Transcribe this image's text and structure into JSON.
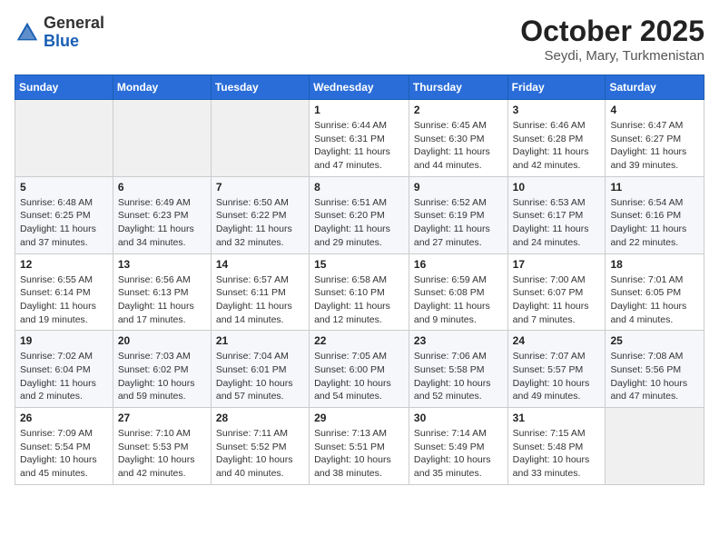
{
  "header": {
    "logo_general": "General",
    "logo_blue": "Blue",
    "month_year": "October 2025",
    "location": "Seydi, Mary, Turkmenistan"
  },
  "weekdays": [
    "Sunday",
    "Monday",
    "Tuesday",
    "Wednesday",
    "Thursday",
    "Friday",
    "Saturday"
  ],
  "weeks": [
    [
      {
        "day": "",
        "sunrise": "",
        "sunset": "",
        "daylight": ""
      },
      {
        "day": "",
        "sunrise": "",
        "sunset": "",
        "daylight": ""
      },
      {
        "day": "",
        "sunrise": "",
        "sunset": "",
        "daylight": ""
      },
      {
        "day": "1",
        "sunrise": "Sunrise: 6:44 AM",
        "sunset": "Sunset: 6:31 PM",
        "daylight": "Daylight: 11 hours and 47 minutes."
      },
      {
        "day": "2",
        "sunrise": "Sunrise: 6:45 AM",
        "sunset": "Sunset: 6:30 PM",
        "daylight": "Daylight: 11 hours and 44 minutes."
      },
      {
        "day": "3",
        "sunrise": "Sunrise: 6:46 AM",
        "sunset": "Sunset: 6:28 PM",
        "daylight": "Daylight: 11 hours and 42 minutes."
      },
      {
        "day": "4",
        "sunrise": "Sunrise: 6:47 AM",
        "sunset": "Sunset: 6:27 PM",
        "daylight": "Daylight: 11 hours and 39 minutes."
      }
    ],
    [
      {
        "day": "5",
        "sunrise": "Sunrise: 6:48 AM",
        "sunset": "Sunset: 6:25 PM",
        "daylight": "Daylight: 11 hours and 37 minutes."
      },
      {
        "day": "6",
        "sunrise": "Sunrise: 6:49 AM",
        "sunset": "Sunset: 6:23 PM",
        "daylight": "Daylight: 11 hours and 34 minutes."
      },
      {
        "day": "7",
        "sunrise": "Sunrise: 6:50 AM",
        "sunset": "Sunset: 6:22 PM",
        "daylight": "Daylight: 11 hours and 32 minutes."
      },
      {
        "day": "8",
        "sunrise": "Sunrise: 6:51 AM",
        "sunset": "Sunset: 6:20 PM",
        "daylight": "Daylight: 11 hours and 29 minutes."
      },
      {
        "day": "9",
        "sunrise": "Sunrise: 6:52 AM",
        "sunset": "Sunset: 6:19 PM",
        "daylight": "Daylight: 11 hours and 27 minutes."
      },
      {
        "day": "10",
        "sunrise": "Sunrise: 6:53 AM",
        "sunset": "Sunset: 6:17 PM",
        "daylight": "Daylight: 11 hours and 24 minutes."
      },
      {
        "day": "11",
        "sunrise": "Sunrise: 6:54 AM",
        "sunset": "Sunset: 6:16 PM",
        "daylight": "Daylight: 11 hours and 22 minutes."
      }
    ],
    [
      {
        "day": "12",
        "sunrise": "Sunrise: 6:55 AM",
        "sunset": "Sunset: 6:14 PM",
        "daylight": "Daylight: 11 hours and 19 minutes."
      },
      {
        "day": "13",
        "sunrise": "Sunrise: 6:56 AM",
        "sunset": "Sunset: 6:13 PM",
        "daylight": "Daylight: 11 hours and 17 minutes."
      },
      {
        "day": "14",
        "sunrise": "Sunrise: 6:57 AM",
        "sunset": "Sunset: 6:11 PM",
        "daylight": "Daylight: 11 hours and 14 minutes."
      },
      {
        "day": "15",
        "sunrise": "Sunrise: 6:58 AM",
        "sunset": "Sunset: 6:10 PM",
        "daylight": "Daylight: 11 hours and 12 minutes."
      },
      {
        "day": "16",
        "sunrise": "Sunrise: 6:59 AM",
        "sunset": "Sunset: 6:08 PM",
        "daylight": "Daylight: 11 hours and 9 minutes."
      },
      {
        "day": "17",
        "sunrise": "Sunrise: 7:00 AM",
        "sunset": "Sunset: 6:07 PM",
        "daylight": "Daylight: 11 hours and 7 minutes."
      },
      {
        "day": "18",
        "sunrise": "Sunrise: 7:01 AM",
        "sunset": "Sunset: 6:05 PM",
        "daylight": "Daylight: 11 hours and 4 minutes."
      }
    ],
    [
      {
        "day": "19",
        "sunrise": "Sunrise: 7:02 AM",
        "sunset": "Sunset: 6:04 PM",
        "daylight": "Daylight: 11 hours and 2 minutes."
      },
      {
        "day": "20",
        "sunrise": "Sunrise: 7:03 AM",
        "sunset": "Sunset: 6:02 PM",
        "daylight": "Daylight: 10 hours and 59 minutes."
      },
      {
        "day": "21",
        "sunrise": "Sunrise: 7:04 AM",
        "sunset": "Sunset: 6:01 PM",
        "daylight": "Daylight: 10 hours and 57 minutes."
      },
      {
        "day": "22",
        "sunrise": "Sunrise: 7:05 AM",
        "sunset": "Sunset: 6:00 PM",
        "daylight": "Daylight: 10 hours and 54 minutes."
      },
      {
        "day": "23",
        "sunrise": "Sunrise: 7:06 AM",
        "sunset": "Sunset: 5:58 PM",
        "daylight": "Daylight: 10 hours and 52 minutes."
      },
      {
        "day": "24",
        "sunrise": "Sunrise: 7:07 AM",
        "sunset": "Sunset: 5:57 PM",
        "daylight": "Daylight: 10 hours and 49 minutes."
      },
      {
        "day": "25",
        "sunrise": "Sunrise: 7:08 AM",
        "sunset": "Sunset: 5:56 PM",
        "daylight": "Daylight: 10 hours and 47 minutes."
      }
    ],
    [
      {
        "day": "26",
        "sunrise": "Sunrise: 7:09 AM",
        "sunset": "Sunset: 5:54 PM",
        "daylight": "Daylight: 10 hours and 45 minutes."
      },
      {
        "day": "27",
        "sunrise": "Sunrise: 7:10 AM",
        "sunset": "Sunset: 5:53 PM",
        "daylight": "Daylight: 10 hours and 42 minutes."
      },
      {
        "day": "28",
        "sunrise": "Sunrise: 7:11 AM",
        "sunset": "Sunset: 5:52 PM",
        "daylight": "Daylight: 10 hours and 40 minutes."
      },
      {
        "day": "29",
        "sunrise": "Sunrise: 7:13 AM",
        "sunset": "Sunset: 5:51 PM",
        "daylight": "Daylight: 10 hours and 38 minutes."
      },
      {
        "day": "30",
        "sunrise": "Sunrise: 7:14 AM",
        "sunset": "Sunset: 5:49 PM",
        "daylight": "Daylight: 10 hours and 35 minutes."
      },
      {
        "day": "31",
        "sunrise": "Sunrise: 7:15 AM",
        "sunset": "Sunset: 5:48 PM",
        "daylight": "Daylight: 10 hours and 33 minutes."
      },
      {
        "day": "",
        "sunrise": "",
        "sunset": "",
        "daylight": ""
      }
    ]
  ]
}
